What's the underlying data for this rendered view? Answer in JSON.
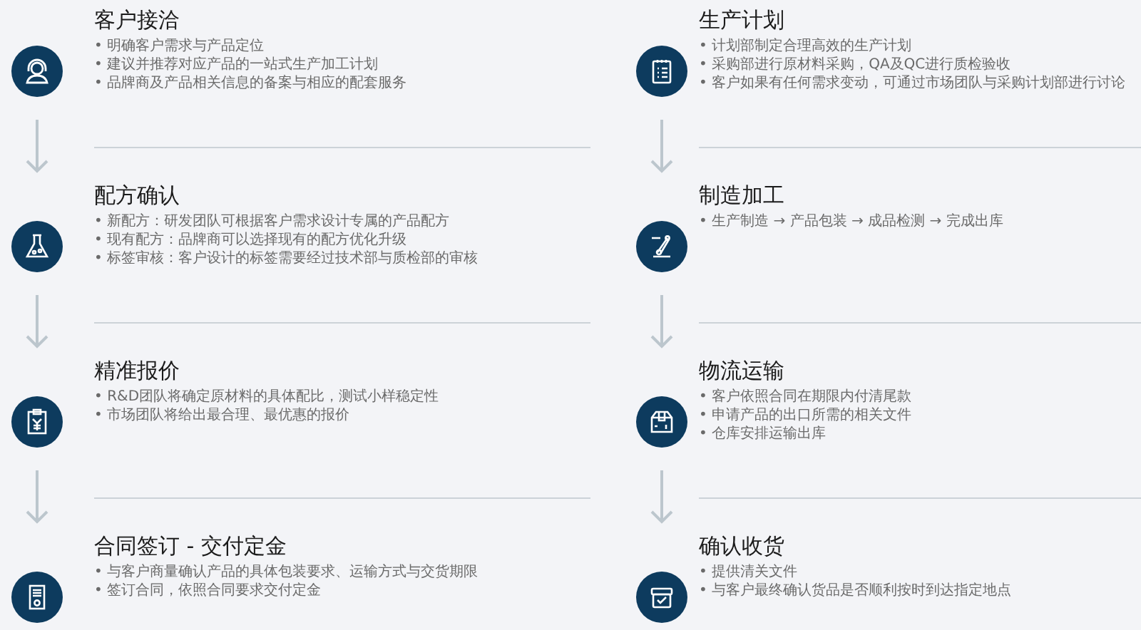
{
  "columns": [
    {
      "steps": [
        {
          "title": "客户接洽",
          "bullets": [
            "• 明确客户需求与产品定位",
            "• 建议并推荐对应产品的一站式生产加工计划",
            "• 品牌商及产品相关信息的备案与相应的配套服务"
          ]
        },
        {
          "title": "配方确认",
          "bullets": [
            "• 新配方：研发团队可根据客户需求设计专属的产品配方",
            "• 现有配方：品牌商可以选择现有的配方优化升级",
            "• 标签审核：客户设计的标签需要经过技术部与质检部的审核"
          ]
        },
        {
          "title": "精准报价",
          "bullets": [
            "• R&D团队将确定原材料的具体配比，测试小样稳定性",
            "• 市场团队将给出最合理、最优惠的报价"
          ]
        },
        {
          "title": "合同签订 - 交付定金",
          "bullets": [
            "• 与客户商量确认产品的具体包装要求、运输方式与交货期限",
            "• 签订合同，依照合同要求交付定金"
          ]
        }
      ]
    },
    {
      "steps": [
        {
          "title": "生产计划",
          "bullets": [
            "• 计划部制定合理高效的生产计划",
            "• 采购部进行原材料采购，QA及QC进行质检验收",
            "• 客户如果有任何需求变动，可通过市场团队与采购计划部进行讨论"
          ]
        },
        {
          "title": "制造加工",
          "bullets": [
            "• 生产制造 → 产品包装 → 成品检测 → 完成出库"
          ]
        },
        {
          "title": "物流运输",
          "bullets": [
            "• 客户依照合同在期限内付清尾款",
            "• 申请产品的出口所需的相关文件",
            "• 仓库安排运输出库"
          ]
        },
        {
          "title": "确认收货",
          "bullets": [
            "• 提供清关文件",
            "• 与客户最终确认货品是否顺利按时到达指定地点"
          ]
        }
      ]
    }
  ]
}
